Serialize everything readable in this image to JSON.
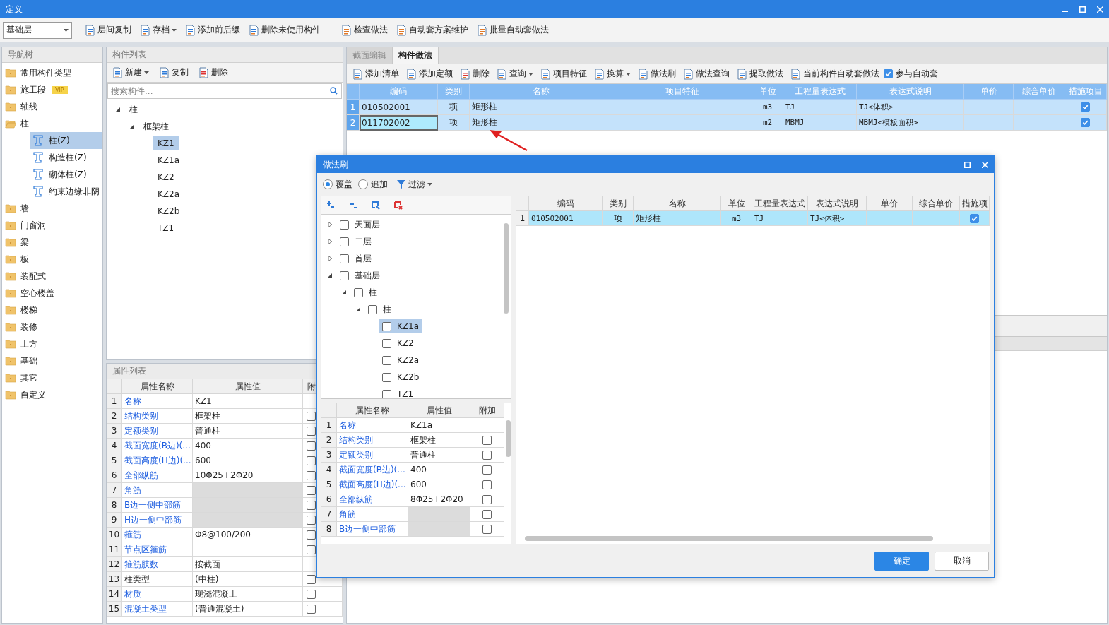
{
  "window": {
    "title": "定义"
  },
  "toolbar": {
    "floor_select": {
      "value": "基础层"
    },
    "groups": [
      [
        {
          "label": "层间复制",
          "dropdown": false
        },
        {
          "label": "存档",
          "dropdown": true
        },
        {
          "label": "添加前后缀",
          "dropdown": false
        },
        {
          "label": "删除未使用构件",
          "dropdown": false
        }
      ],
      [
        {
          "label": "检查做法",
          "dropdown": false
        },
        {
          "label": "自动套方案维护",
          "dropdown": false
        },
        {
          "label": "批量自动套做法",
          "dropdown": false
        }
      ]
    ]
  },
  "nav_tree": {
    "title": "导航树",
    "items": [
      {
        "label": "常用构件类型",
        "expanded": false
      },
      {
        "label": "施工段",
        "expanded": false,
        "badge": "VIP"
      },
      {
        "label": "轴线",
        "expanded": false
      },
      {
        "label": "柱",
        "expanded": true,
        "children": [
          {
            "label": "柱(Z)",
            "selected": true
          },
          {
            "label": "构造柱(Z)",
            "selected": false
          },
          {
            "label": "砌体柱(Z)",
            "selected": false
          },
          {
            "label": "约束边缘非阴",
            "selected": false
          }
        ]
      },
      {
        "label": "墙",
        "expanded": false
      },
      {
        "label": "门窗洞",
        "expanded": false
      },
      {
        "label": "梁",
        "expanded": false
      },
      {
        "label": "板",
        "expanded": false
      },
      {
        "label": "装配式",
        "expanded": false
      },
      {
        "label": "空心楼盖",
        "expanded": false
      },
      {
        "label": "楼梯",
        "expanded": false
      },
      {
        "label": "装修",
        "expanded": false
      },
      {
        "label": "土方",
        "expanded": false
      },
      {
        "label": "基础",
        "expanded": false
      },
      {
        "label": "其它",
        "expanded": false
      },
      {
        "label": "自定义",
        "expanded": false
      }
    ]
  },
  "component_list": {
    "title": "构件列表",
    "buttons": [
      {
        "label": "新建",
        "dropdown": true
      },
      {
        "label": "复制",
        "dropdown": false
      },
      {
        "label": "删除",
        "dropdown": false
      }
    ],
    "search": {
      "placeholder": "搜索构件..."
    },
    "tree": [
      {
        "label": "柱",
        "expanded": true,
        "children": [
          {
            "label": "框架柱",
            "expanded": true,
            "children": [
              {
                "label": "KZ1",
                "selected": true
              },
              {
                "label": "KZ1a",
                "selected": false
              },
              {
                "label": "KZ2",
                "selected": false
              },
              {
                "label": "KZ2a",
                "selected": false
              },
              {
                "label": "KZ2b",
                "selected": false
              },
              {
                "label": "TZ1",
                "selected": false
              }
            ]
          }
        ]
      }
    ]
  },
  "property_list": {
    "title": "属性列表",
    "columns": [
      "属性名称",
      "属性值",
      "附"
    ],
    "rows": [
      {
        "no": "1",
        "name": "名称",
        "value": "KZ1",
        "link": true,
        "shaded": false
      },
      {
        "no": "2",
        "name": "结构类别",
        "value": "框架柱",
        "link": true,
        "shaded": false,
        "attach": false
      },
      {
        "no": "3",
        "name": "定额类别",
        "value": "普通柱",
        "link": true,
        "shaded": false,
        "attach": false
      },
      {
        "no": "4",
        "name": "截面宽度(B边)(...",
        "value": "400",
        "link": true,
        "shaded": false,
        "attach": false
      },
      {
        "no": "5",
        "name": "截面高度(H边)(...",
        "value": "600",
        "link": true,
        "shaded": false,
        "attach": false
      },
      {
        "no": "6",
        "name": "全部纵筋",
        "value": "10Φ25+2Φ20",
        "link": true,
        "shaded": false,
        "attach": false
      },
      {
        "no": "7",
        "name": "角筋",
        "link": true,
        "shaded": true,
        "attach": false
      },
      {
        "no": "8",
        "name": "B边一侧中部筋",
        "link": true,
        "shaded": true,
        "attach": false
      },
      {
        "no": "9",
        "name": "H边一侧中部筋",
        "link": true,
        "shaded": true,
        "attach": false
      },
      {
        "no": "10",
        "name": "箍筋",
        "value": "Φ8@100/200",
        "link": true,
        "shaded": false,
        "attach": false
      },
      {
        "no": "11",
        "name": "节点区箍筋",
        "link": true,
        "shaded": false,
        "attach": false
      },
      {
        "no": "12",
        "name": "箍筋肢数",
        "value": "按截面",
        "link": true,
        "shaded": false
      },
      {
        "no": "13",
        "name": "柱类型",
        "value": "(中柱)",
        "link": false,
        "shaded": false,
        "attach": false
      },
      {
        "no": "14",
        "name": "材质",
        "value": "现浇混凝土",
        "link": true,
        "shaded": false,
        "attach": false
      },
      {
        "no": "15",
        "name": "混凝土类型",
        "value": "(普通混凝土)",
        "link": true,
        "shaded": false,
        "attach": false
      }
    ]
  },
  "method_panel": {
    "tabs": [
      {
        "label": "截面编辑",
        "selected": false
      },
      {
        "label": "构件做法",
        "selected": true
      }
    ],
    "buttons": [
      {
        "label": "添加清单",
        "dropdown": false
      },
      {
        "label": "添加定额",
        "dropdown": false
      },
      {
        "label": "删除",
        "dropdown": false
      },
      {
        "label": "查询",
        "dropdown": true
      },
      {
        "label": "项目特征",
        "dropdown": false
      },
      {
        "label": "换算",
        "dropdown": true
      },
      {
        "label": "做法刷",
        "dropdown": false
      },
      {
        "label": "做法查询",
        "dropdown": false
      },
      {
        "label": "提取做法",
        "dropdown": false
      },
      {
        "label": "当前构件自动套做法",
        "dropdown": false
      }
    ],
    "auto_apply": {
      "label": "参与自动套",
      "checked": true
    },
    "table": {
      "columns": [
        "编码",
        "类别",
        "名称",
        "项目特征",
        "单位",
        "工程量表达式",
        "表达式说明",
        "单价",
        "综合单价",
        "措施项目"
      ],
      "rows": [
        {
          "no": "1",
          "code": "010502001",
          "type": "项",
          "name": "矩形柱",
          "unit": "m3",
          "expr": "TJ",
          "expr_desc": "TJ<体积>",
          "measure": true,
          "selected": true,
          "editing": false
        },
        {
          "no": "2",
          "code": "011702002",
          "type": "项",
          "name": "矩形柱",
          "unit": "m2",
          "expr": "MBMJ",
          "expr_desc": "MBMJ<模板面积>",
          "measure": true,
          "selected": true,
          "editing": true
        }
      ]
    }
  },
  "dialog": {
    "title": "做法刷",
    "options": [
      {
        "label": "覆盖",
        "selected": true
      },
      {
        "label": "追加",
        "selected": false
      }
    ],
    "filter": {
      "label": "过滤",
      "dropdown": true
    },
    "floor_tree": [
      {
        "label": "天面层",
        "expanded": false,
        "checked": false
      },
      {
        "label": "二层",
        "expanded": false,
        "checked": false
      },
      {
        "label": "首层",
        "expanded": false,
        "checked": false
      },
      {
        "label": "基础层",
        "expanded": true,
        "checked": false,
        "children": [
          {
            "label": "柱",
            "expanded": true,
            "checked": false,
            "children": [
              {
                "label": "柱",
                "expanded": true,
                "checked": false,
                "children": [
                  {
                    "label": "KZ1a",
                    "checked": false,
                    "selected": true
                  },
                  {
                    "label": "KZ2",
                    "checked": false,
                    "selected": false
                  },
                  {
                    "label": "KZ2a",
                    "checked": false,
                    "selected": false
                  },
                  {
                    "label": "KZ2b",
                    "checked": false,
                    "selected": false
                  },
                  {
                    "label": "TZ1",
                    "checked": false,
                    "selected": false
                  }
                ]
              }
            ]
          }
        ]
      }
    ],
    "property_table": {
      "columns": [
        "属性名称",
        "属性值",
        "附加"
      ],
      "rows": [
        {
          "no": "1",
          "name": "名称",
          "value": "KZ1a",
          "shaded": false
        },
        {
          "no": "2",
          "name": "结构类别",
          "value": "框架柱",
          "shaded": false,
          "attach": false
        },
        {
          "no": "3",
          "name": "定额类别",
          "value": "普通柱",
          "shaded": false,
          "attach": false
        },
        {
          "no": "4",
          "name": "截面宽度(B边)(...",
          "value": "400",
          "shaded": false,
          "attach": false
        },
        {
          "no": "5",
          "name": "截面高度(H边)(...",
          "value": "600",
          "shaded": false,
          "attach": false
        },
        {
          "no": "6",
          "name": "全部纵筋",
          "value": "8Φ25+2Φ20",
          "shaded": false,
          "attach": false
        },
        {
          "no": "7",
          "name": "角筋",
          "shaded": true,
          "attach": false
        },
        {
          "no": "8",
          "name": "B边一侧中部筋",
          "shaded": true,
          "attach": false
        }
      ]
    },
    "table": {
      "columns": [
        "编码",
        "类别",
        "名称",
        "单位",
        "工程量表达式",
        "表达式说明",
        "单价",
        "综合单价",
        "措施项"
      ],
      "rows": [
        {
          "no": "1",
          "code": "010502001",
          "type": "项",
          "name": "矩形柱",
          "unit": "m3",
          "expr": "TJ",
          "expr_desc": "TJ<体积>",
          "measure": true,
          "selected": true
        }
      ]
    },
    "buttons": [
      {
        "label": "确定",
        "primary": true
      },
      {
        "label": "取消",
        "primary": false
      }
    ]
  }
}
